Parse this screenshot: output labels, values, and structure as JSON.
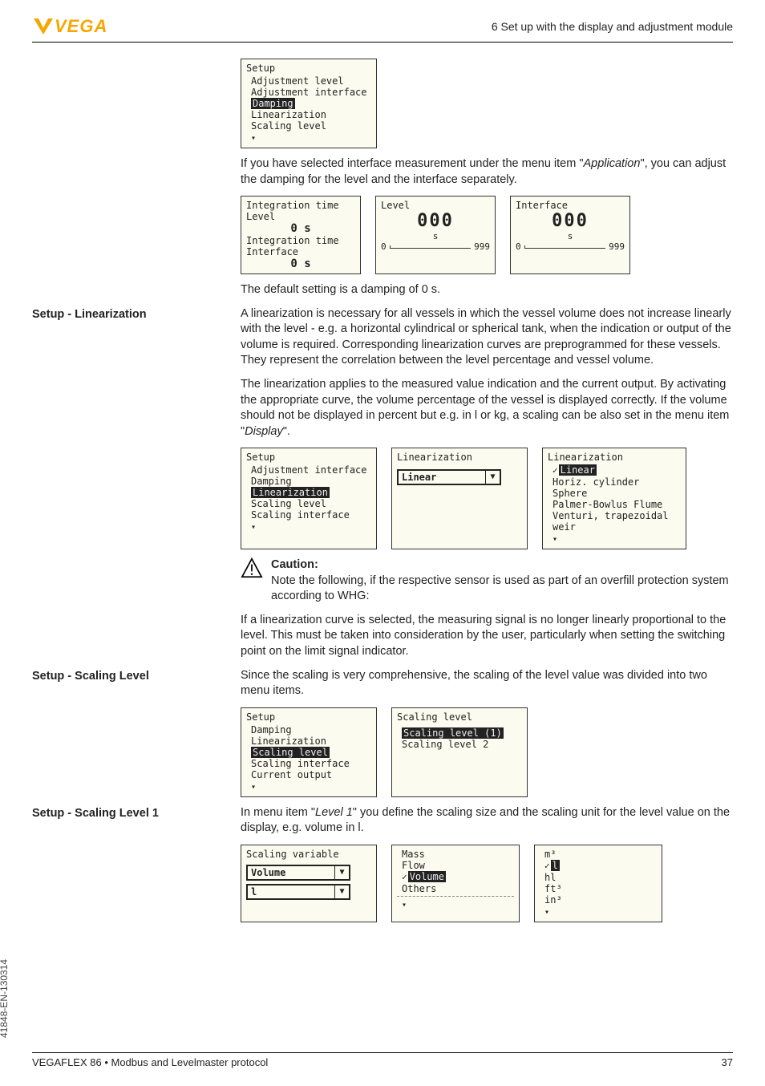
{
  "header": {
    "logo_text": "VEGA",
    "chapter": "6 Set up with the display and adjustment module"
  },
  "vtext": "41848-EN-130314",
  "footer": {
    "product": "VEGAFLEX 86 • Modbus and Levelmaster protocol",
    "page": "37"
  },
  "setup_box": {
    "title": "Setup",
    "items": [
      "Adjustment level",
      "Adjustment interface"
    ],
    "hl": "Damping",
    "after": [
      "Linearization",
      "Scaling level"
    ]
  },
  "para1a": "If you have selected interface measurement under the menu item \"",
  "para1_app": "Application",
  "para1b": "\", you can adjust the damping for the level and the interface separately.",
  "damping_lcd1": {
    "l1": "Integration time",
    "l2": "Level",
    "v1": "0 s",
    "l3": "Integration time",
    "l4": "Interface",
    "v2": "0 s"
  },
  "damping_lcd2": {
    "title": "Level",
    "big": "000",
    "unit": "s",
    "min": "0",
    "max": "999"
  },
  "damping_lcd3": {
    "title": "Interface",
    "big": "000",
    "unit": "s",
    "min": "0",
    "max": "999"
  },
  "para_default_damping": "The default setting is a damping of 0 s.",
  "sec_lin": {
    "heading": "Setup - Linearization",
    "p1": "A linearization is necessary for all vessels in which the vessel volume does not increase linearly with the level - e.g. a horizontal cylindrical or spherical tank, when the indication or output of the volume is required. Corresponding linearization curves are preprogrammed for these vessels. They represent the correlation between the level percentage and vessel volume.",
    "p2a": "The linearization applies to the measured value indication and the current output. By activating the appropriate curve, the volume percentage of the vessel is displayed correctly. If the volume should not be displayed in percent but e.g. in l or kg, a scaling can be also set in the menu item \"",
    "p2_disp": "Display",
    "p2b": "\"."
  },
  "lin_box1": {
    "title": "Setup",
    "items": [
      "Adjustment interface",
      "Damping"
    ],
    "hl": "Linearization",
    "after": [
      "Scaling level",
      "Scaling interface"
    ]
  },
  "lin_box2": {
    "title": "Linearization",
    "value": "Linear"
  },
  "lin_box3": {
    "title": "Linearization",
    "hl": "Linear",
    "after": [
      "Horiz. cylinder",
      "Sphere",
      "Palmer-Bowlus Flume",
      "Venturi, trapezoidal weir"
    ]
  },
  "caution": {
    "head": "Caution:",
    "body1": "Note the following, if the respective sensor is used as part of an overfill protection system according to WHG:",
    "body2": "If a linearization curve is selected, the measuring signal is no longer linearly proportional to the level. This must be taken into consideration by the user, particularly when setting the switching point on the limit signal indicator."
  },
  "sec_scl": {
    "heading": "Setup - Scaling Level",
    "p1": "Since the scaling is very comprehensive, the scaling of the level value was divided into two menu items."
  },
  "scl_box1": {
    "title": "Setup",
    "items": [
      "Damping",
      "Linearization"
    ],
    "hl": "Scaling level",
    "after": [
      "Scaling interface",
      "Current output"
    ]
  },
  "scl_box2": {
    "title": "Scaling level",
    "hl": "Scaling level (1)",
    "after": [
      "Scaling level 2"
    ]
  },
  "sec_scl1": {
    "heading": "Setup - Scaling Level 1",
    "p1a": "In menu item \"",
    "p1_it": "Level 1",
    "p1b": "\" you define the scaling size and the scaling unit for the level value on the display, e.g. volume in l."
  },
  "sv_box1": {
    "title": "Scaling variable",
    "dd1": "Volume",
    "dd2": "l"
  },
  "sv_box2": {
    "items": [
      "Mass",
      "Flow"
    ],
    "hl": "Volume",
    "after": [
      "Others"
    ]
  },
  "sv_box3": {
    "items": [
      "m³"
    ],
    "hl": "l",
    "after": [
      "hl",
      "ft³",
      "in³"
    ]
  }
}
